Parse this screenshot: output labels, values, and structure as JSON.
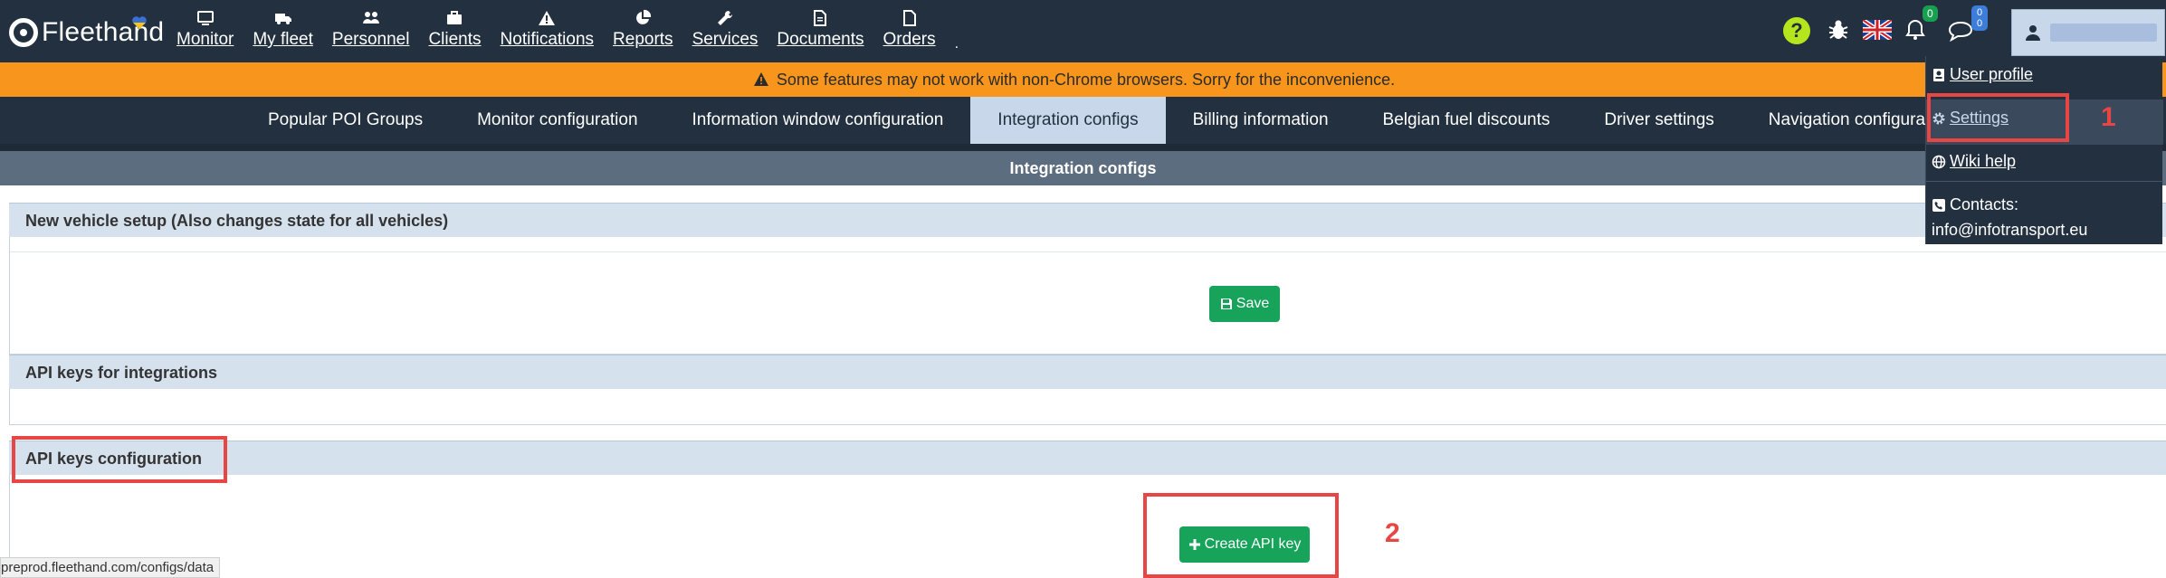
{
  "app": {
    "logo_text": "Fleethand"
  },
  "nav": {
    "items": [
      {
        "label": "Monitor",
        "icon": "monitor-icon"
      },
      {
        "label": "My fleet",
        "icon": "truck-icon"
      },
      {
        "label": "Personnel",
        "icon": "people-icon"
      },
      {
        "label": "Clients",
        "icon": "briefcase-icon"
      },
      {
        "label": "Notifications",
        "icon": "warning-icon"
      },
      {
        "label": "Reports",
        "icon": "pie-chart-icon"
      },
      {
        "label": "Services",
        "icon": "wrench-icon"
      },
      {
        "label": "Documents",
        "icon": "document-icon"
      },
      {
        "label": "Orders",
        "icon": "file-icon"
      }
    ],
    "trailing": "."
  },
  "header_right": {
    "help_label": "?",
    "notifications_count": "0",
    "messages_count_top": "0",
    "messages_count_bottom": "0"
  },
  "warning": {
    "text": "Some features may not work with non-Chrome browsers. Sorry for the inconvenience."
  },
  "settings_tabs": {
    "items": [
      {
        "label": "Popular POI Groups",
        "active": false
      },
      {
        "label": "Monitor configuration",
        "active": false
      },
      {
        "label": "Information window configuration",
        "active": false
      },
      {
        "label": "Integration configs",
        "active": true
      },
      {
        "label": "Billing information",
        "active": false
      },
      {
        "label": "Belgian fuel discounts",
        "active": false
      },
      {
        "label": "Driver settings",
        "active": false
      },
      {
        "label": "Navigation configuration",
        "active": false
      }
    ]
  },
  "page": {
    "title": "Integration configs"
  },
  "panels": {
    "vehicle_setup_title": "New vehicle setup (Also changes state for all vehicles)",
    "save_label": "Save",
    "api_keys_title": "API keys for integrations",
    "api_config_title": "API keys configuration",
    "create_api_key_label": "Create API key"
  },
  "dropdown": {
    "user_profile": "User profile",
    "settings": "Settings",
    "wiki_help": "Wiki help",
    "contacts_label": "Contacts:",
    "contacts_email": "info@infotransport.eu"
  },
  "annotations": {
    "step1": "1",
    "step2": "2"
  },
  "status_url": "preprod.fleethand.com/configs/data",
  "colors": {
    "header_bg": "#22303f",
    "warning_bg": "#f7951d",
    "active_tab_bg": "#c9d7ea",
    "button_green": "#17a35a",
    "annotation_red": "#e84545",
    "help_yellow": "#b5e61d"
  }
}
